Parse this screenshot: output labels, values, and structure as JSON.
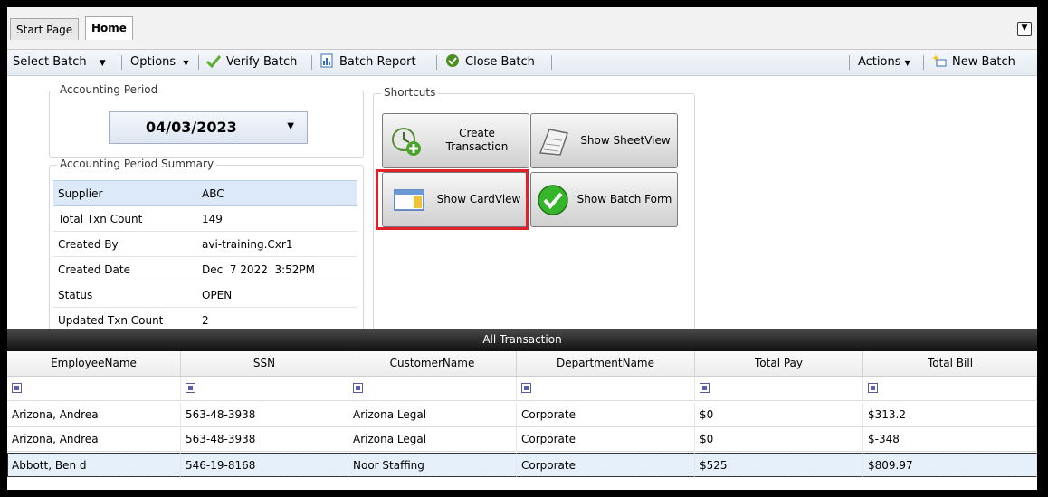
{
  "tabs": [
    {
      "label": "Start Page"
    },
    {
      "label": "Home"
    }
  ],
  "toolbar": {
    "select_batch": "Select Batch",
    "options": "Options",
    "verify_batch": "Verify Batch",
    "batch_report": "Batch Report",
    "close_batch": "Close Batch",
    "actions": "Actions",
    "new_batch": "New Batch"
  },
  "accounting_period": {
    "title": "Accounting Period",
    "value": "04/03/2023"
  },
  "summary": {
    "title": "Accounting Period Summary",
    "rows": [
      {
        "label": "Supplier",
        "value": "ABC"
      },
      {
        "label": "Total Txn Count",
        "value": "149"
      },
      {
        "label": "Created By",
        "value": "avi-training.Cxr1"
      },
      {
        "label": "Created Date",
        "value": "Dec  7 2022  3:52PM"
      },
      {
        "label": "Status",
        "value": "OPEN"
      },
      {
        "label": "Updated Txn Count",
        "value": "2"
      }
    ]
  },
  "shortcuts": {
    "title": "Shortcuts",
    "create_transaction": "Create Transaction",
    "show_sheetview": "Show SheetView",
    "show_cardview": "Show CardView",
    "show_batch_form": "Show Batch Form"
  },
  "grid": {
    "title": "All Transaction",
    "columns": [
      "EmployeeName",
      "SSN",
      "CustomerName",
      "DepartmentName",
      "Total Pay",
      "Total Bill"
    ],
    "rows": [
      [
        "Arizona, Andrea",
        "563-48-3938",
        "Arizona Legal",
        "Corporate",
        "$0",
        "$313.2"
      ],
      [
        "Arizona, Andrea",
        "563-48-3938",
        "Arizona Legal",
        "Corporate",
        "$0",
        "$-348"
      ],
      [
        "Abbott, Ben d",
        "546-19-8168",
        "Noor Staffing",
        "Corporate",
        "$525",
        "$809.97"
      ]
    ]
  },
  "colors": {
    "highlight": "#e0202a",
    "grid_header": "#111111",
    "selected_row": "#e6f0fa"
  }
}
